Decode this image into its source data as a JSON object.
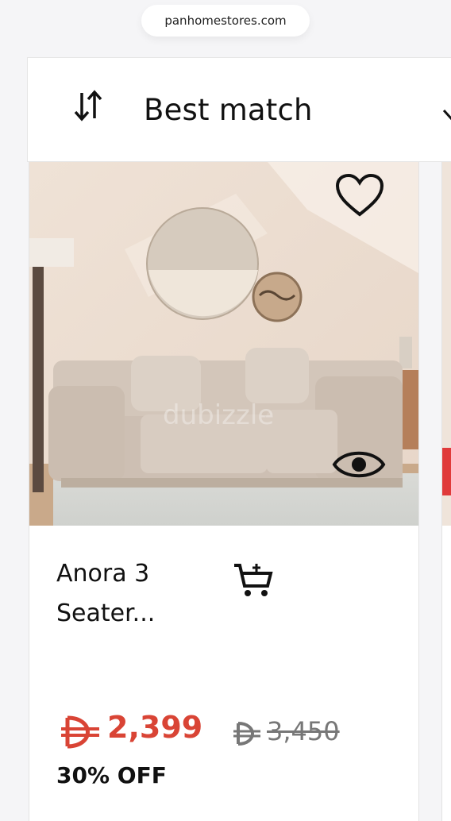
{
  "browser": {
    "url": "panhomestores.com"
  },
  "sort": {
    "label": "Best match",
    "icon": "sort-arrows-icon",
    "chevron": "chevron-down-icon"
  },
  "product": {
    "title": "Anora 3 Seater...",
    "watermark": "dubizzle",
    "price_current": "2,399",
    "price_old": "3,450",
    "currency_icon": "dirham-icon",
    "discount": "30% OFF",
    "wishlist_icon": "heart-icon",
    "quick_view_icon": "eye-icon",
    "cart_icon": "add-to-cart-icon"
  },
  "colors": {
    "price": "#d94435",
    "old_price": "#777777",
    "text": "#111111"
  }
}
